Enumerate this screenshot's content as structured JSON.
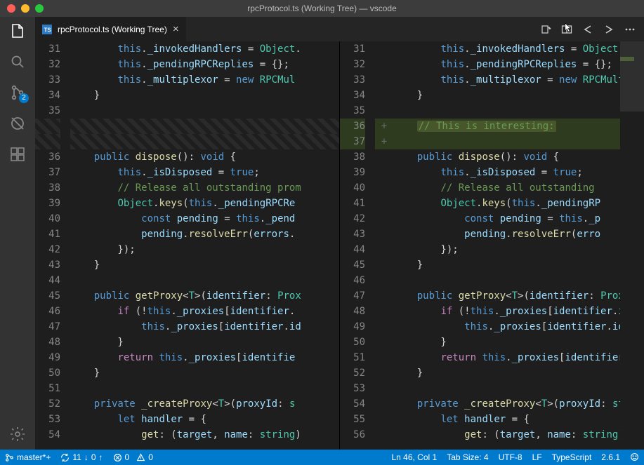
{
  "window": {
    "title": "rpcProtocol.ts (Working Tree) — vscode"
  },
  "activity": {
    "scm_badge": "2"
  },
  "tab": {
    "label": "rpcProtocol.ts (Working Tree)"
  },
  "left_pane": [
    {
      "n": "31",
      "t": [
        "        ",
        "this",
        ".",
        "_invokedHandlers",
        " = ",
        "Object",
        "."
      ],
      "cls": [
        "",
        "kw",
        "pn",
        "prop",
        "op",
        "id",
        "pn"
      ]
    },
    {
      "n": "32",
      "t": [
        "        ",
        "this",
        ".",
        "_pendingRPCReplies",
        " = {};"
      ],
      "cls": [
        "",
        "kw",
        "pn",
        "prop",
        "op"
      ]
    },
    {
      "n": "33",
      "t": [
        "        ",
        "this",
        ".",
        "_multiplexor",
        " = ",
        "new",
        " ",
        "RPCMul"
      ],
      "cls": [
        "",
        "kw",
        "pn",
        "prop",
        "op",
        "kw",
        "",
        "id"
      ]
    },
    {
      "n": "34",
      "t": [
        "    }"
      ],
      "cls": [
        "pn"
      ]
    },
    {
      "n": "35",
      "t": [
        ""
      ],
      "cls": [
        ""
      ]
    },
    {
      "n": "",
      "deleted": true
    },
    {
      "n": "",
      "deleted": true
    },
    {
      "n": "36",
      "t": [
        "    ",
        "public",
        " ",
        "dispose",
        "(): ",
        "void",
        " {"
      ],
      "cls": [
        "",
        "kw",
        "",
        "fn",
        "pn",
        "kw",
        "pn"
      ]
    },
    {
      "n": "37",
      "t": [
        "        ",
        "this",
        ".",
        "_isDisposed",
        " = ",
        "true",
        ";"
      ],
      "cls": [
        "",
        "kw",
        "pn",
        "prop",
        "op",
        "kw",
        "pn"
      ]
    },
    {
      "n": "38",
      "t": [
        "        ",
        "// Release all outstanding prom"
      ],
      "cls": [
        "",
        "cm"
      ]
    },
    {
      "n": "39",
      "t": [
        "        ",
        "Object",
        ".",
        "keys",
        "(",
        "this",
        ".",
        "_pendingRPCRe"
      ],
      "cls": [
        "",
        "id",
        "pn",
        "fn",
        "pn",
        "kw",
        "pn",
        "prop"
      ]
    },
    {
      "n": "40",
      "t": [
        "            ",
        "const",
        " ",
        "pending",
        " = ",
        "this",
        ".",
        "_pend"
      ],
      "cls": [
        "",
        "kw",
        "",
        "prop",
        "op",
        "kw",
        "pn",
        "prop"
      ]
    },
    {
      "n": "41",
      "t": [
        "            ",
        "pending",
        ".",
        "resolveErr",
        "(",
        "errors",
        "."
      ],
      "cls": [
        "",
        "prop",
        "pn",
        "fn",
        "pn",
        "prop",
        "pn"
      ]
    },
    {
      "n": "42",
      "t": [
        "        });"
      ],
      "cls": [
        "pn"
      ]
    },
    {
      "n": "43",
      "t": [
        "    }"
      ],
      "cls": [
        "pn"
      ]
    },
    {
      "n": "44",
      "t": [
        ""
      ],
      "cls": [
        ""
      ]
    },
    {
      "n": "45",
      "t": [
        "    ",
        "public",
        " ",
        "getProxy",
        "<",
        "T",
        ">(",
        "identifier",
        ": ",
        "Prox"
      ],
      "cls": [
        "",
        "kw",
        "",
        "fn",
        "pn",
        "id",
        "pn",
        "prop",
        "pn",
        "id"
      ]
    },
    {
      "n": "46",
      "t": [
        "        ",
        "if",
        " (!",
        "this",
        ".",
        "_proxies",
        "[",
        "identifier",
        "."
      ],
      "cls": [
        "",
        "kw2",
        "pn",
        "kw",
        "pn",
        "prop",
        "pn",
        "prop",
        "pn"
      ]
    },
    {
      "n": "47",
      "t": [
        "            ",
        "this",
        ".",
        "_proxies",
        "[",
        "identifier",
        ".",
        "id"
      ],
      "cls": [
        "",
        "kw",
        "pn",
        "prop",
        "pn",
        "prop",
        "pn",
        "prop"
      ]
    },
    {
      "n": "48",
      "t": [
        "        }"
      ],
      "cls": [
        "pn"
      ]
    },
    {
      "n": "49",
      "t": [
        "        ",
        "return",
        " ",
        "this",
        ".",
        "_proxies",
        "[",
        "identifie"
      ],
      "cls": [
        "",
        "kw2",
        "",
        "kw",
        "pn",
        "prop",
        "pn",
        "prop"
      ]
    },
    {
      "n": "50",
      "t": [
        "    }"
      ],
      "cls": [
        "pn"
      ]
    },
    {
      "n": "51",
      "t": [
        ""
      ],
      "cls": [
        ""
      ]
    },
    {
      "n": "52",
      "t": [
        "    ",
        "private",
        " ",
        "_createProxy",
        "<",
        "T",
        ">(",
        "proxyId",
        ": ",
        "s"
      ],
      "cls": [
        "",
        "kw",
        "",
        "fn",
        "pn",
        "id",
        "pn",
        "prop",
        "pn",
        "id"
      ]
    },
    {
      "n": "53",
      "t": [
        "        ",
        "let",
        " ",
        "handler",
        " = {"
      ],
      "cls": [
        "",
        "kw",
        "",
        "prop",
        "pn"
      ]
    },
    {
      "n": "54",
      "t": [
        "            ",
        "get",
        ": (",
        "target",
        ", ",
        "name",
        ": ",
        "string",
        ")"
      ],
      "cls": [
        "",
        "fn",
        "pn",
        "prop",
        "pn",
        "prop",
        "pn",
        "id",
        "pn"
      ]
    }
  ],
  "right_pane": [
    {
      "n": "31",
      "t": [
        "        ",
        "this",
        ".",
        "_invokedHandlers",
        " = ",
        "Object",
        "."
      ],
      "cls": [
        "",
        "kw",
        "pn",
        "prop",
        "op",
        "id",
        "pn"
      ]
    },
    {
      "n": "32",
      "t": [
        "        ",
        "this",
        ".",
        "_pendingRPCReplies",
        " = {};"
      ],
      "cls": [
        "",
        "kw",
        "pn",
        "prop",
        "op"
      ]
    },
    {
      "n": "33",
      "t": [
        "        ",
        "this",
        ".",
        "_multiplexor",
        " = ",
        "new",
        " ",
        "RPCMult"
      ],
      "cls": [
        "",
        "kw",
        "pn",
        "prop",
        "op",
        "kw",
        "",
        "id"
      ]
    },
    {
      "n": "34",
      "t": [
        "    }"
      ],
      "cls": [
        "pn"
      ]
    },
    {
      "n": "35",
      "t": [
        ""
      ],
      "cls": [
        ""
      ]
    },
    {
      "n": "36",
      "mark": "+",
      "added": true,
      "t": [
        "    ",
        "// This is interesting:"
      ],
      "cls": [
        "",
        "cm"
      ]
    },
    {
      "n": "37",
      "mark": "+",
      "added": true,
      "t": [
        ""
      ],
      "cls": [
        ""
      ]
    },
    {
      "n": "38",
      "t": [
        "    ",
        "public",
        " ",
        "dispose",
        "(): ",
        "void",
        " {"
      ],
      "cls": [
        "",
        "kw",
        "",
        "fn",
        "pn",
        "kw",
        "pn"
      ]
    },
    {
      "n": "39",
      "t": [
        "        ",
        "this",
        ".",
        "_isDisposed",
        " = ",
        "true",
        ";"
      ],
      "cls": [
        "",
        "kw",
        "pn",
        "prop",
        "op",
        "kw",
        "pn"
      ]
    },
    {
      "n": "40",
      "t": [
        "        ",
        "// Release all outstanding "
      ],
      "cls": [
        "",
        "cm"
      ]
    },
    {
      "n": "41",
      "t": [
        "        ",
        "Object",
        ".",
        "keys",
        "(",
        "this",
        ".",
        "_pendingRP"
      ],
      "cls": [
        "",
        "id",
        "pn",
        "fn",
        "pn",
        "kw",
        "pn",
        "prop"
      ]
    },
    {
      "n": "42",
      "t": [
        "            ",
        "const",
        " ",
        "pending",
        " = ",
        "this",
        ".",
        "_p"
      ],
      "cls": [
        "",
        "kw",
        "",
        "prop",
        "op",
        "kw",
        "pn",
        "prop"
      ]
    },
    {
      "n": "43",
      "t": [
        "            ",
        "pending",
        ".",
        "resolveErr",
        "(",
        "erro"
      ],
      "cls": [
        "",
        "prop",
        "pn",
        "fn",
        "pn",
        "prop"
      ]
    },
    {
      "n": "44",
      "t": [
        "        });"
      ],
      "cls": [
        "pn"
      ]
    },
    {
      "n": "45",
      "t": [
        "    }"
      ],
      "cls": [
        "pn"
      ]
    },
    {
      "n": "46",
      "t": [
        ""
      ],
      "cls": [
        ""
      ]
    },
    {
      "n": "47",
      "t": [
        "    ",
        "public",
        " ",
        "getProxy",
        "<",
        "T",
        ">(",
        "identifier",
        ": ",
        "Prox"
      ],
      "cls": [
        "",
        "kw",
        "",
        "fn",
        "pn",
        "id",
        "pn",
        "prop",
        "pn",
        "id"
      ]
    },
    {
      "n": "48",
      "t": [
        "        ",
        "if",
        " (!",
        "this",
        ".",
        "_proxies",
        "[",
        "identifier",
        ".",
        "i"
      ],
      "cls": [
        "",
        "kw2",
        "pn",
        "kw",
        "pn",
        "prop",
        "pn",
        "prop",
        "pn",
        "prop"
      ]
    },
    {
      "n": "49",
      "t": [
        "            ",
        "this",
        ".",
        "_proxies",
        "[",
        "identifier",
        ".",
        "id"
      ],
      "cls": [
        "",
        "kw",
        "pn",
        "prop",
        "pn",
        "prop",
        "pn",
        "prop"
      ]
    },
    {
      "n": "50",
      "t": [
        "        }"
      ],
      "cls": [
        "pn"
      ]
    },
    {
      "n": "51",
      "t": [
        "        ",
        "return",
        " ",
        "this",
        ".",
        "_proxies",
        "[",
        "identifier"
      ],
      "cls": [
        "",
        "kw2",
        "",
        "kw",
        "pn",
        "prop",
        "pn",
        "prop"
      ]
    },
    {
      "n": "52",
      "t": [
        "    }"
      ],
      "cls": [
        "pn"
      ]
    },
    {
      "n": "53",
      "t": [
        ""
      ],
      "cls": [
        ""
      ]
    },
    {
      "n": "54",
      "t": [
        "    ",
        "private",
        " ",
        "_createProxy",
        "<",
        "T",
        ">(",
        "proxyId",
        ": ",
        "st"
      ],
      "cls": [
        "",
        "kw",
        "",
        "fn",
        "pn",
        "id",
        "pn",
        "prop",
        "pn",
        "id"
      ]
    },
    {
      "n": "55",
      "t": [
        "        ",
        "let",
        " ",
        "handler",
        " = {"
      ],
      "cls": [
        "",
        "kw",
        "",
        "prop",
        "pn"
      ]
    },
    {
      "n": "56",
      "t": [
        "            ",
        "get",
        ": (",
        "target",
        ", ",
        "name",
        ": ",
        "string",
        ")"
      ],
      "cls": [
        "",
        "fn",
        "pn",
        "prop",
        "pn",
        "prop",
        "pn",
        "id",
        "pn"
      ]
    }
  ],
  "status": {
    "branch": "master*+",
    "sync_down": "11",
    "sync_up": "0",
    "errors": "0",
    "warnings": "0",
    "position": "Ln 46, Col 1",
    "tabsize": "Tab Size: 4",
    "encoding": "UTF-8",
    "eol": "LF",
    "language": "TypeScript",
    "version": "2.6.1"
  }
}
